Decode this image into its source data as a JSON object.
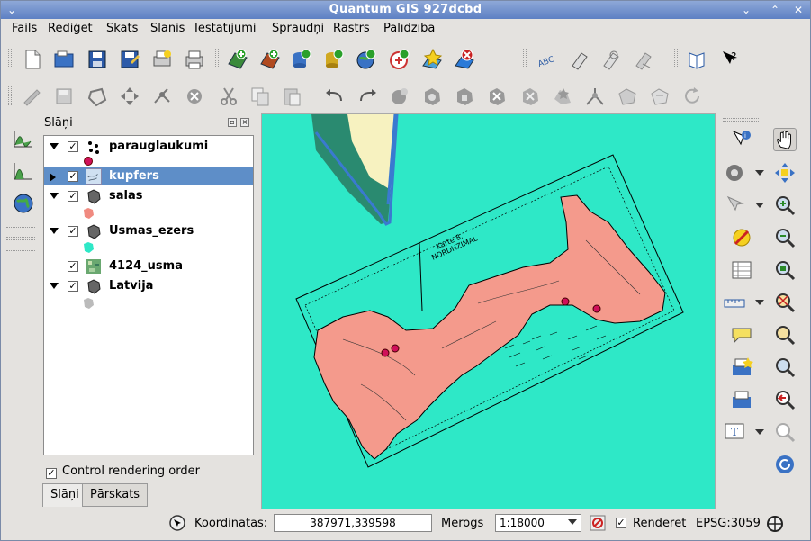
{
  "window": {
    "title": "Quantum GIS 927dcbd"
  },
  "menu": [
    "Fails",
    "Rediģēt",
    "Skats",
    "Slānis",
    "Iestatījumi",
    "Spraudņi",
    "Rastrs",
    "Palīdzība"
  ],
  "panel": {
    "title": "Slāņi",
    "layers": [
      {
        "name": "parauglaukumi",
        "checked": true,
        "expanded": true,
        "legend_color": "#d0105a",
        "icon": "points-icon"
      },
      {
        "name": "kupfers",
        "checked": true,
        "expanded": false,
        "selected": true,
        "icon": "raster-scan-icon"
      },
      {
        "name": "salas",
        "checked": true,
        "expanded": true,
        "legend_color": "#f08a80",
        "icon": "polygon-icon"
      },
      {
        "name": "Usmas_ezers",
        "checked": true,
        "expanded": true,
        "legend_color": "#2ee8c7",
        "icon": "polygon-icon"
      },
      {
        "name": "4124_usma",
        "checked": true,
        "expanded": false,
        "icon": "raster-icon"
      },
      {
        "name": "Latvija",
        "checked": true,
        "expanded": true,
        "legend_color": "#bbbbbb",
        "icon": "polygon-icon"
      }
    ],
    "control_render_label": "Control rendering order",
    "tabs": [
      "Slāņi",
      "Pārskats"
    ]
  },
  "map": {
    "background": "#2ee8c7",
    "island_color": "#f49a8c",
    "scan_text_1": "Karte 8.",
    "scan_text_2": "NORDHZIMAL"
  },
  "status": {
    "coords_label": "Koordinātas:",
    "coords_value": "387971,339598",
    "scale_label": "Mērogs",
    "scale_value": "1:18000",
    "render_label": "Renderēt",
    "epsg": "EPSG:3059"
  }
}
